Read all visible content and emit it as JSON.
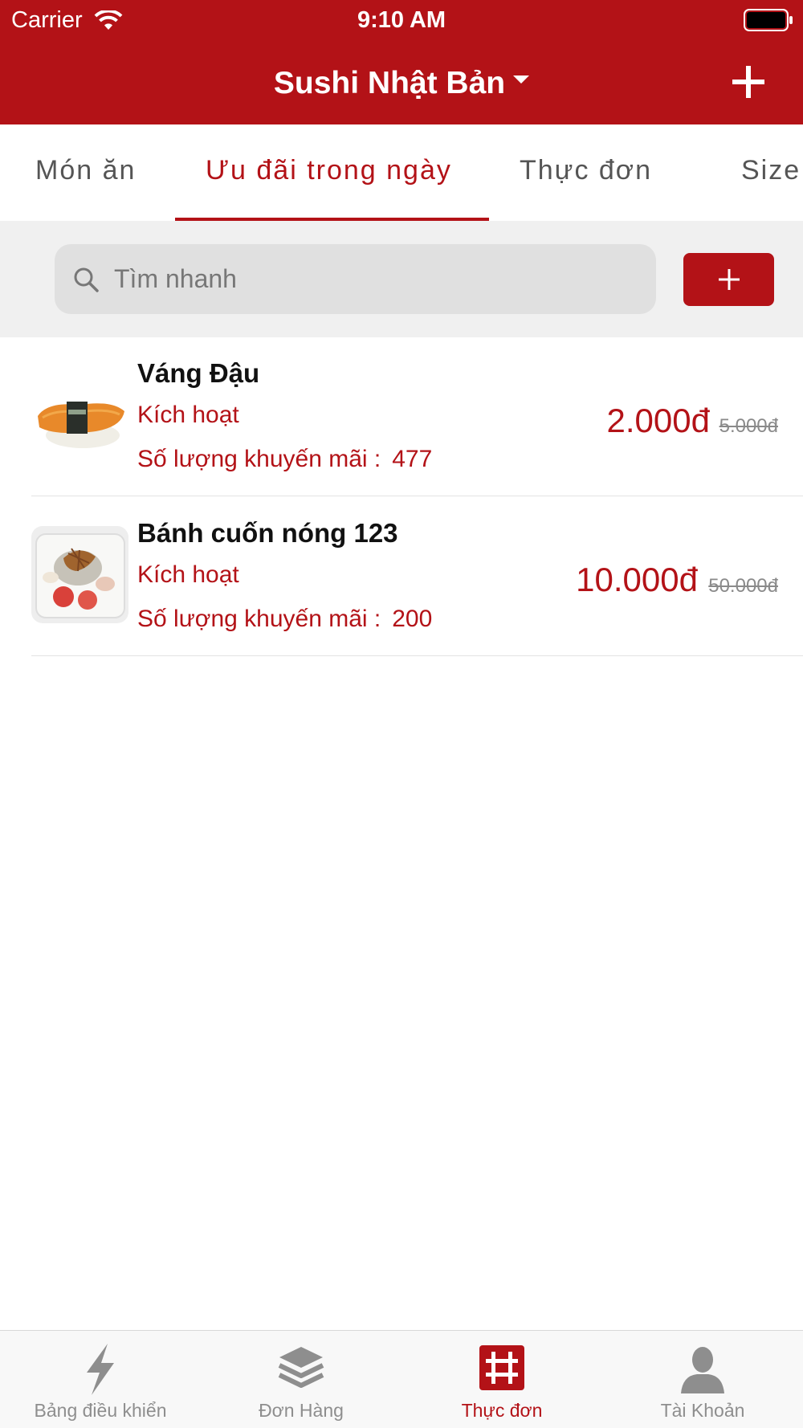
{
  "status_bar": {
    "carrier": "Carrier",
    "time": "9:10 AM"
  },
  "nav": {
    "title": "Sushi Nhật Bản"
  },
  "tabs": [
    {
      "label": "Món ăn",
      "active": false
    },
    {
      "label": "Ưu đãi trong ngày",
      "active": true
    },
    {
      "label": "Thực đơn",
      "active": false
    },
    {
      "label": "Size",
      "active": false
    }
  ],
  "search": {
    "placeholder": "Tìm nhanh",
    "value": ""
  },
  "items": [
    {
      "name": "Váng Đậu",
      "status": "Kích hoạt",
      "qty_label": "Số lượng khuyến mãi :",
      "qty_value": "477",
      "price": "2.000đ",
      "old_price": "5.000đ",
      "image": "sushi"
    },
    {
      "name": "Bánh cuốn nóng 123",
      "status": "Kích hoạt",
      "qty_label": "Số lượng khuyến mãi :",
      "qty_value": "200",
      "price": "10.000đ",
      "old_price": "50.000đ",
      "image": "banh-cuon"
    }
  ],
  "tabbar": [
    {
      "label": "Bảng điều khiển",
      "icon": "lightning-icon",
      "active": false
    },
    {
      "label": "Đơn Hàng",
      "icon": "layers-icon",
      "active": false
    },
    {
      "label": "Thực đơn",
      "icon": "grid-icon",
      "active": true
    },
    {
      "label": "Tài Khoản",
      "icon": "user-icon",
      "active": false
    }
  ],
  "colors": {
    "brand": "#b31217",
    "inactive": "#8e8e8e"
  }
}
